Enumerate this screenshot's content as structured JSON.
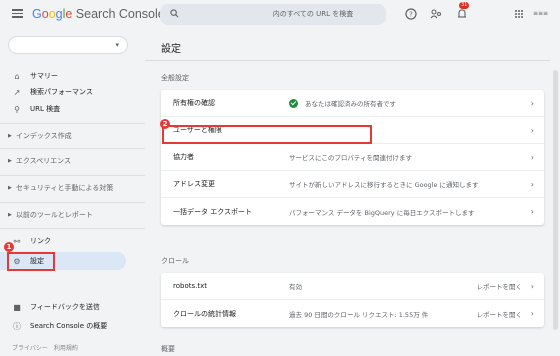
{
  "app": {
    "logo_parts": [
      "G",
      "o",
      "o",
      "g",
      "l",
      "e",
      " Search Console"
    ],
    "search_placeholder": "内のすべての URL を検査",
    "notification_count": "31",
    "avatar_text": "≡≡≡"
  },
  "sidebar": {
    "nav": [
      {
        "label": "サマリー",
        "icon": "home-icon"
      },
      {
        "label": "検索パフォーマンス",
        "icon": "trending-icon"
      },
      {
        "label": "URL 検査",
        "icon": "search-icon"
      }
    ],
    "groups": [
      {
        "label": "インデックス作成"
      },
      {
        "label": "エクスペリエンス"
      },
      {
        "label": "セキュリティと手動による対策"
      },
      {
        "label": "以前のツールとレポート"
      }
    ],
    "links_label": "リンク",
    "settings_label": "設定",
    "feedback_label": "フィードバックを送信",
    "about_label": "Search Console の概要",
    "privacy_label": "プライバシー　利用規約"
  },
  "main": {
    "page_title": "設定",
    "general_section": "全般設定",
    "general_rows": [
      {
        "label": "所有権の確認",
        "desc": "あなたは確認済みの所有者です",
        "verified": true
      },
      {
        "label": "ユーザーと権限",
        "desc": ""
      },
      {
        "label": "協力者",
        "desc": "サービスにこのプロパティを関連付けます"
      },
      {
        "label": "アドレス変更",
        "desc": "サイトが新しいアドレスに移行するときに Google に通知します"
      },
      {
        "label": "一括データ エクスポート",
        "desc": "パフォーマンス データを BigQuery に毎日エクスポートします"
      }
    ],
    "crawl_section": "クロール",
    "crawl_rows": [
      {
        "label": "robots.txt",
        "desc": "有効",
        "link": "レポートを開く"
      },
      {
        "label": "クロールの統計情報",
        "desc": "過去 90 日間のクロール リクエスト: 1.55万 件",
        "link": "レポートを開く"
      }
    ],
    "about_section": "概要"
  },
  "annotations": [
    "1",
    "2"
  ],
  "colors": {
    "accent": "#1a73e8",
    "highlight": "#e53935",
    "active_bg": "#dbe6f6"
  }
}
